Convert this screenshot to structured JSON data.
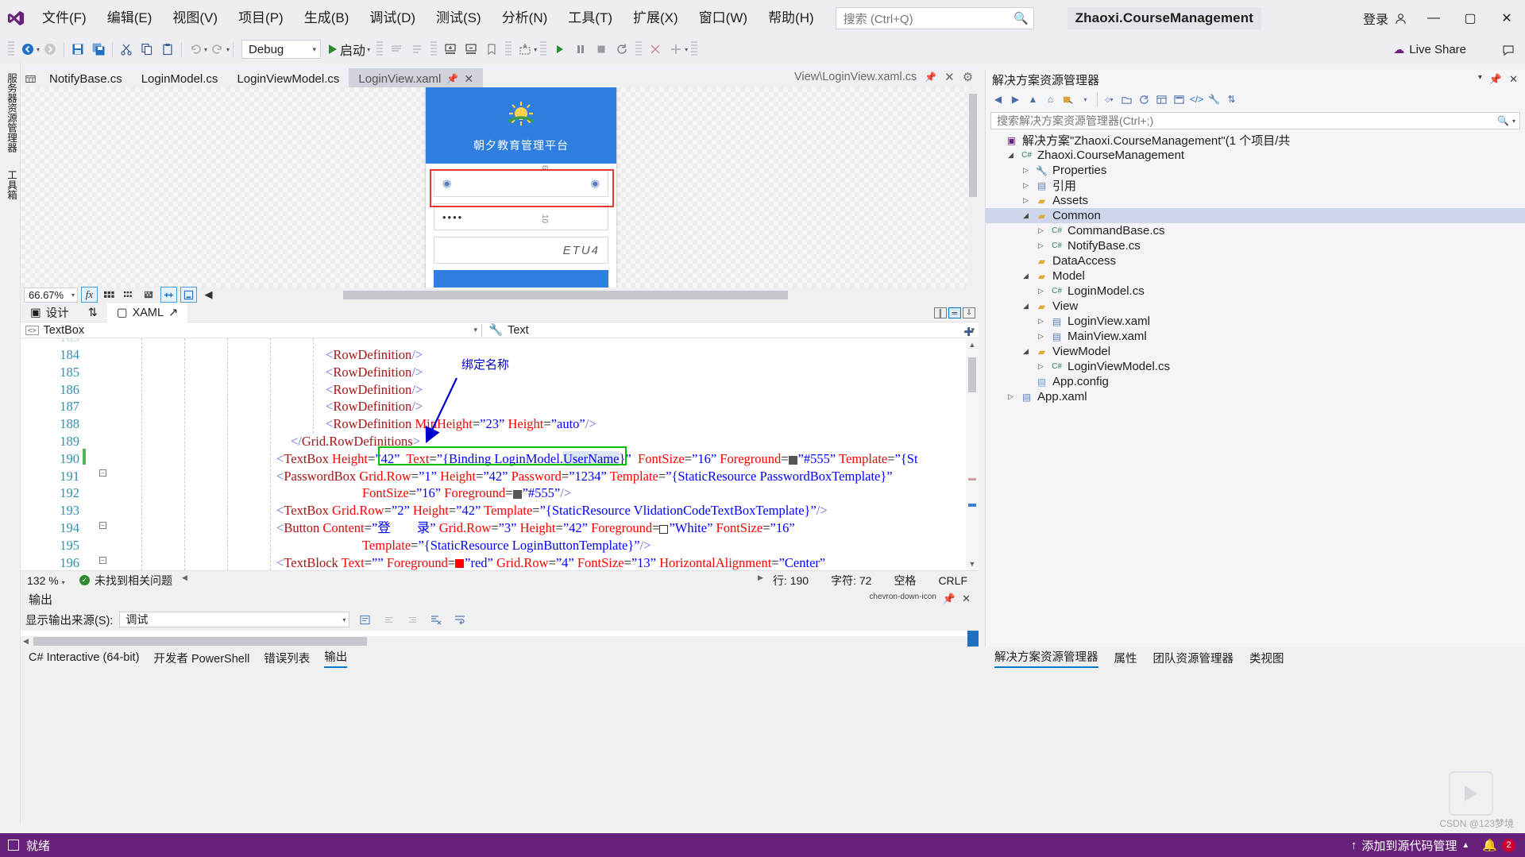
{
  "titlebar": {
    "logo_icon": "visual-studio-logo",
    "menus": [
      {
        "label": "文件(F)"
      },
      {
        "label": "编辑(E)"
      },
      {
        "label": "视图(V)"
      },
      {
        "label": "项目(P)"
      },
      {
        "label": "生成(B)"
      },
      {
        "label": "调试(D)"
      },
      {
        "label": "测试(S)"
      },
      {
        "label": "分析(N)"
      },
      {
        "label": "工具(T)"
      },
      {
        "label": "扩展(X)"
      },
      {
        "label": "窗口(W)"
      },
      {
        "label": "帮助(H)"
      }
    ],
    "search_placeholder": "搜索 (Ctrl+Q)",
    "search_icon": "search-icon",
    "solution_name": "Zhaoxi.CourseManagement",
    "signin_label": "登录",
    "signin_icon": "account-icon",
    "minimize_icon": "—",
    "maximize_icon": "▢",
    "close_icon": "✕"
  },
  "toolbar": {
    "back_icon": "navigate-back-icon",
    "forward_icon": "navigate-forward-icon",
    "save_icon": "save-icon",
    "save_all_icon": "save-all-icon",
    "cut_icon": "cut-icon",
    "copy_icon": "copy-icon",
    "paste_icon": "paste-icon",
    "undo_icon": "undo-icon",
    "redo_icon": "redo-icon",
    "configuration": "Debug",
    "start_label": "启动",
    "start_icon": "play-icon",
    "comment_icon": "comment-icon",
    "uncomment_icon": "uncomment-icon",
    "indent_icon": "indent-icon",
    "outdent_icon": "outdent-icon",
    "bookmark_icon": "bookmark-icon",
    "step_icon": "step-icon",
    "breakpoint_icon": "breakpoint-icon",
    "continue_icon": "continue-icon",
    "pause_icon": "pause-icon",
    "stop_icon": "stop-icon",
    "live_share_label": "Live Share",
    "live_share_icon": "live-share-icon",
    "feedback_icon": "feedback-icon"
  },
  "vertical_tabs": [
    {
      "label": "服务器资源管理器"
    },
    {
      "label": "工具箱"
    }
  ],
  "document_tabs": [
    {
      "label": "NotifyBase.cs",
      "active": false
    },
    {
      "label": "LoginModel.cs",
      "active": false
    },
    {
      "label": "LoginViewModel.cs",
      "active": false
    },
    {
      "label": "LoginView.xaml",
      "active": true,
      "pin_icon": "pin-icon",
      "close_icon": "✕"
    }
  ],
  "document_path": {
    "label": "View\\LoginView.xaml.cs",
    "pin_icon": "pin-icon",
    "close_icon": "✕",
    "settings_icon": "gear-icon"
  },
  "designer": {
    "app_header_title": "朝夕教育管理平台",
    "logo_icon": "sunrise-logo-icon",
    "username_placeholder": "",
    "password_value": "••••",
    "verification_code": "ETU4",
    "eye_icon": "eye-icon",
    "ruler_marks": [
      "6",
      "10",
      "10"
    ],
    "selection_color": "#e53935"
  },
  "designer_toolbar": {
    "zoom_level": "66.67%",
    "effects_icon": "fx-icon",
    "grid_icon": "grid-icon",
    "snap_icon": "snap-grid-icon",
    "snaplines_icon": "snaplines-icon",
    "align_icon": "align-icon",
    "refresh_icon": "refresh-designer-icon",
    "collapse_icon": "◀"
  },
  "designer_tabs": {
    "design_label": "设计",
    "design_icon": "design-view-icon",
    "swap_icon": "swap-panes-icon",
    "xaml_label": "XAML",
    "xaml_icon": "xaml-view-icon",
    "popout_icon": "pop-out-icon",
    "split_vertical_icon": "split-vertical-icon",
    "split_horizontal_icon": "split-horizontal-icon",
    "collapse_pane_icon": "collapse-pane-icon"
  },
  "selector_bar": {
    "element": "TextBox",
    "element_icon": "element-icon",
    "property": "Text",
    "property_icon": "wrench-icon",
    "add_icon": "add-icon"
  },
  "editor": {
    "lines": [
      {
        "num": "184",
        "indent": 384,
        "html": "<span class='k-brk'>&lt;</span><span class='k-tag'>RowDefinition</span><span class='k-brk'>/&gt;</span>"
      },
      {
        "num": "185",
        "indent": 384,
        "html": "<span class='k-brk'>&lt;</span><span class='k-tag'>RowDefinition</span><span class='k-brk'>/&gt;</span>"
      },
      {
        "num": "186",
        "indent": 384,
        "html": "<span class='k-brk'>&lt;</span><span class='k-tag'>RowDefinition</span><span class='k-brk'>/&gt;</span>"
      },
      {
        "num": "187",
        "indent": 384,
        "html": "<span class='k-brk'>&lt;</span><span class='k-tag'>RowDefinition</span><span class='k-brk'>/&gt;</span>"
      },
      {
        "num": "188",
        "indent": 384,
        "html": "<span class='k-brk'>&lt;</span><span class='k-tag'>RowDefinition</span> <span class='k-attr'>MinHeight</span><span class='k-plain'>=</span><span class='k-val'>”23”</span> <span class='k-attr'>Height</span><span class='k-plain'>=</span><span class='k-val'>”auto”</span><span class='k-brk'>/&gt;</span>"
      },
      {
        "num": "189",
        "indent": 340,
        "html": "<span class='k-brk'>&lt;/</span><span class='k-tag'>Grid.RowDefinitions</span><span class='k-brk'>&gt;</span>"
      },
      {
        "num": "190",
        "indent": 322,
        "html": "<span class='k-brk'>&lt;</span><span class='k-tag'>TextBox</span> <span class='k-attr'>Height</span><span class='k-plain'>=</span><span class='k-val'>”42”</span>  <span class='k-attr'>Text</span><span class='k-plain'>=</span><span class='k-val'>”{Binding LoginModel.</span><span class='k-sel'>UserName</span><span class='k-val'>}”</span>  <span class='k-attr'>FontSize</span><span class='k-plain'>=</span><span class='k-val'>”16”</span> <span class='k-attr'>Foreground</span><span class='k-plain'>=</span><span class='sw' style='background:#555'></span><span class='k-val'>”#555”</span> <span class='k-attr'>Template</span><span class='k-plain'>=</span><span class='k-val'>”{St</span>"
      },
      {
        "num": "191",
        "indent": 322,
        "html": "<span class='k-brk'>&lt;</span><span class='k-tag'>PasswordBox</span> <span class='k-attr'>Grid.Row</span><span class='k-plain'>=</span><span class='k-val'>”1”</span> <span class='k-attr'>Height</span><span class='k-plain'>=</span><span class='k-val'>”42”</span> <span class='k-attr'>Password</span><span class='k-plain'>=</span><span class='k-val'>”1234”</span> <span class='k-attr'>Template</span><span class='k-plain'>=</span><span class='k-val'>”{StaticResource PasswordBoxTemplate}”</span>"
      },
      {
        "num": "192",
        "indent": 430,
        "html": "<span class='k-attr'>FontSize</span><span class='k-plain'>=</span><span class='k-val'>”16”</span> <span class='k-attr'>Foreground</span><span class='k-plain'>=</span><span class='sw' style='background:#555'></span><span class='k-val'>”#555”</span><span class='k-brk'>/&gt;</span>"
      },
      {
        "num": "193",
        "indent": 322,
        "html": "<span class='k-brk'>&lt;</span><span class='k-tag'>TextBox</span> <span class='k-attr'>Grid.Row</span><span class='k-plain'>=</span><span class='k-val'>”2”</span> <span class='k-attr'>Height</span><span class='k-plain'>=</span><span class='k-val'>”42”</span> <span class='k-attr'>Template</span><span class='k-plain'>=</span><span class='k-val'>”{StaticResource VlidationCodeTextBoxTemplate}”</span><span class='k-brk'>/&gt;</span>"
      },
      {
        "num": "194",
        "indent": 322,
        "html": "<span class='k-brk'>&lt;</span><span class='k-tag'>Button</span> <span class='k-attr'>Content</span><span class='k-plain'>=</span><span class='k-val'>”登　　录”</span> <span class='k-attr'>Grid.Row</span><span class='k-plain'>=</span><span class='k-val'>”3”</span> <span class='k-attr'>Height</span><span class='k-plain'>=</span><span class='k-val'>”42”</span> <span class='k-attr'>Foreground</span><span class='k-plain'>=</span><span class='sw' style='background:#fff;border:1px solid #333'></span><span class='k-val'>”White”</span> <span class='k-attr'>FontSize</span><span class='k-plain'>=</span><span class='k-val'>”16”</span>"
      },
      {
        "num": "195",
        "indent": 430,
        "html": "<span class='k-attr'>Template</span><span class='k-plain'>=</span><span class='k-val'>”{StaticResource LoginButtonTemplate}”</span><span class='k-brk'>/&gt;</span>"
      },
      {
        "num": "196",
        "indent": 322,
        "html": "<span class='k-brk'>&lt;</span><span class='k-tag'>TextBlock</span> <span class='k-attr'>Text</span><span class='k-plain'>=</span><span class='k-val'>””</span> <span class='k-attr'>Foreground</span><span class='k-plain'>=</span><span class='sw' style='background:#f00'></span><span class='k-val'>”red”</span> <span class='k-attr'>Grid.Row</span><span class='k-plain'>=</span><span class='k-val'>”4”</span> <span class='k-attr'>FontSize</span><span class='k-plain'>=</span><span class='k-val'>”13”</span> <span class='k-attr'>HorizontalAlignment</span><span class='k-plain'>=</span><span class='k-val'>”Center”</span>"
      }
    ],
    "annotation": "绑定名称",
    "annotation_color": "#0000cc",
    "highlight_color": "#00c000"
  },
  "editor_status": {
    "zoom": "132 %",
    "issues": "未找到相关问题",
    "line_label": "行: 190",
    "col_label": "字符: 72",
    "space_label": "空格",
    "eol_label": "CRLF"
  },
  "output": {
    "title": "输出",
    "source_label": "显示输出来源(S):",
    "source_value": "调试",
    "pin_icon": "pin-icon",
    "close_icon": "✕",
    "dropdown_icon": "chevron-down-icon",
    "clear_icon": "clear-output-icon",
    "toggle_wrap_icon": "word-wrap-icon"
  },
  "bottom_tabs": [
    {
      "label": "C# Interactive (64-bit)",
      "active": false
    },
    {
      "label": "开发者 PowerShell",
      "active": false
    },
    {
      "label": "错误列表",
      "active": false
    },
    {
      "label": "输出",
      "active": true
    }
  ],
  "solution_explorer": {
    "title": "解决方案资源管理器",
    "pin_icon": "pin-icon",
    "close_icon": "✕",
    "dropdown_icon": "chevron-down-icon",
    "search_placeholder": "搜索解决方案资源管理器(Ctrl+;)",
    "search_icon": "search-icon",
    "toolbar_icons": [
      "back-icon",
      "forward-icon",
      "home-icon",
      "refresh-icon",
      "pending-changes-icon",
      "collapse-all-icon",
      "show-all-files-icon",
      "properties-icon",
      "preview-icon",
      "view-code-icon",
      "settings-icon",
      "sync-icon"
    ],
    "tree": [
      {
        "depth": 0,
        "twisty": "",
        "icon": "solution-icon",
        "label": "解决方案\"Zhaoxi.CourseManagement\"(1 个项目/共",
        "sel": false
      },
      {
        "depth": 1,
        "twisty": "▲",
        "icon": "csproj-icon",
        "label": "Zhaoxi.CourseManagement",
        "sel": false
      },
      {
        "depth": 2,
        "twisty": "▷",
        "icon": "wrench-icon",
        "label": "Properties",
        "sel": false
      },
      {
        "depth": 2,
        "twisty": "▷",
        "icon": "references-icon",
        "label": "引用",
        "sel": false
      },
      {
        "depth": 2,
        "twisty": "▷",
        "icon": "folder-icon",
        "label": "Assets",
        "sel": false
      },
      {
        "depth": 2,
        "twisty": "▲",
        "icon": "folder-icon",
        "label": "Common",
        "sel": true
      },
      {
        "depth": 3,
        "twisty": "▷",
        "icon": "cs-icon",
        "label": "CommandBase.cs",
        "sel": false
      },
      {
        "depth": 3,
        "twisty": "▷",
        "icon": "cs-icon",
        "label": "NotifyBase.cs",
        "sel": false
      },
      {
        "depth": 2,
        "twisty": "",
        "icon": "folder-icon",
        "label": "DataAccess",
        "sel": false
      },
      {
        "depth": 2,
        "twisty": "▲",
        "icon": "folder-icon",
        "label": "Model",
        "sel": false
      },
      {
        "depth": 3,
        "twisty": "▷",
        "icon": "cs-icon",
        "label": "LoginModel.cs",
        "sel": false
      },
      {
        "depth": 2,
        "twisty": "▲",
        "icon": "folder-icon",
        "label": "View",
        "sel": false
      },
      {
        "depth": 3,
        "twisty": "▷",
        "icon": "xaml-icon",
        "label": "LoginView.xaml",
        "sel": false
      },
      {
        "depth": 3,
        "twisty": "▷",
        "icon": "xaml-icon",
        "label": "MainView.xaml",
        "sel": false
      },
      {
        "depth": 2,
        "twisty": "▲",
        "icon": "folder-icon",
        "label": "ViewModel",
        "sel": false
      },
      {
        "depth": 3,
        "twisty": "▷",
        "icon": "cs-icon",
        "label": "LoginViewModel.cs",
        "sel": false
      },
      {
        "depth": 2,
        "twisty": "",
        "icon": "config-icon",
        "label": "App.config",
        "sel": false
      },
      {
        "depth": 1,
        "twisty": "▷",
        "icon": "xaml-icon",
        "label": "App.xaml",
        "sel": false
      }
    ]
  },
  "right_tabs": [
    {
      "label": "解决方案资源管理器",
      "active": true
    },
    {
      "label": "属性",
      "active": false
    },
    {
      "label": "团队资源管理器",
      "active": false
    },
    {
      "label": "类视图",
      "active": false
    }
  ],
  "statusbar": {
    "ready": "就绪",
    "ready_icon": "stop-square-icon",
    "source_control": "添加到源代码管理",
    "source_control_icon": "up-arrow-icon",
    "notify_count": "2",
    "bell_icon": "bell-icon"
  },
  "watermark": "CSDN @123梦境"
}
